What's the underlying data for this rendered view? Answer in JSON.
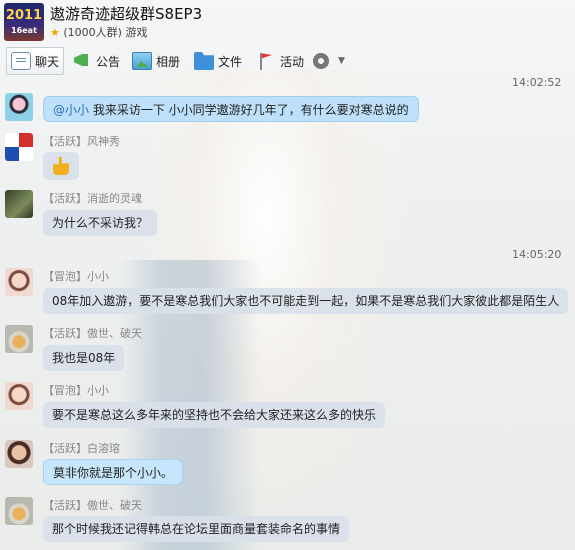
{
  "group": {
    "avatar_year": "2011",
    "avatar_tag": "16eat",
    "title": "遨游奇迹超级群S8EP3",
    "subtitle": "(1000人群) 游戏"
  },
  "toolbar": [
    {
      "label": "聊天",
      "icon": "chat-icon"
    },
    {
      "label": "公告",
      "icon": "announcement-icon"
    },
    {
      "label": "相册",
      "icon": "album-icon"
    },
    {
      "label": "文件",
      "icon": "folder-icon"
    },
    {
      "label": "活动",
      "icon": "flag-icon"
    },
    {
      "label": "",
      "icon": "gear-icon"
    }
  ],
  "timestamps": [
    "14:02:52",
    "14:05:20"
  ],
  "messages": [
    {
      "tag": "",
      "sender": "",
      "mention": "@小小",
      "text": " 我来采访一下 小小同学遨游好几年了，有什么要对寒总说的"
    },
    {
      "tag": "【活跃】",
      "sender": "风神秀",
      "text": "",
      "emoji": "thumbs-up"
    },
    {
      "tag": "【活跃】",
      "sender": "消逝的灵魂",
      "text": "为什么不采访我？"
    },
    {
      "tag": "【冒泡】",
      "sender": "小小",
      "text": "08年加入遨游，要不是寒总我们大家也不可能走到一起，如果不是寒总我们大家彼此都是陌生人"
    },
    {
      "tag": "【活跃】",
      "sender": "傲世、破天",
      "text": "我也是08年"
    },
    {
      "tag": "【冒泡】",
      "sender": "小小",
      "text": "要不是寒总这么多年来的坚持也不会给大家还来这么多的快乐"
    },
    {
      "tag": "【活跃】",
      "sender": "白溶瑢",
      "text": "莫非你就是那个小小。"
    },
    {
      "tag": "【活跃】",
      "sender": "傲世、破天",
      "text": "那个时候我还记得韩总在论坛里面商量套装命名的事情"
    }
  ]
}
